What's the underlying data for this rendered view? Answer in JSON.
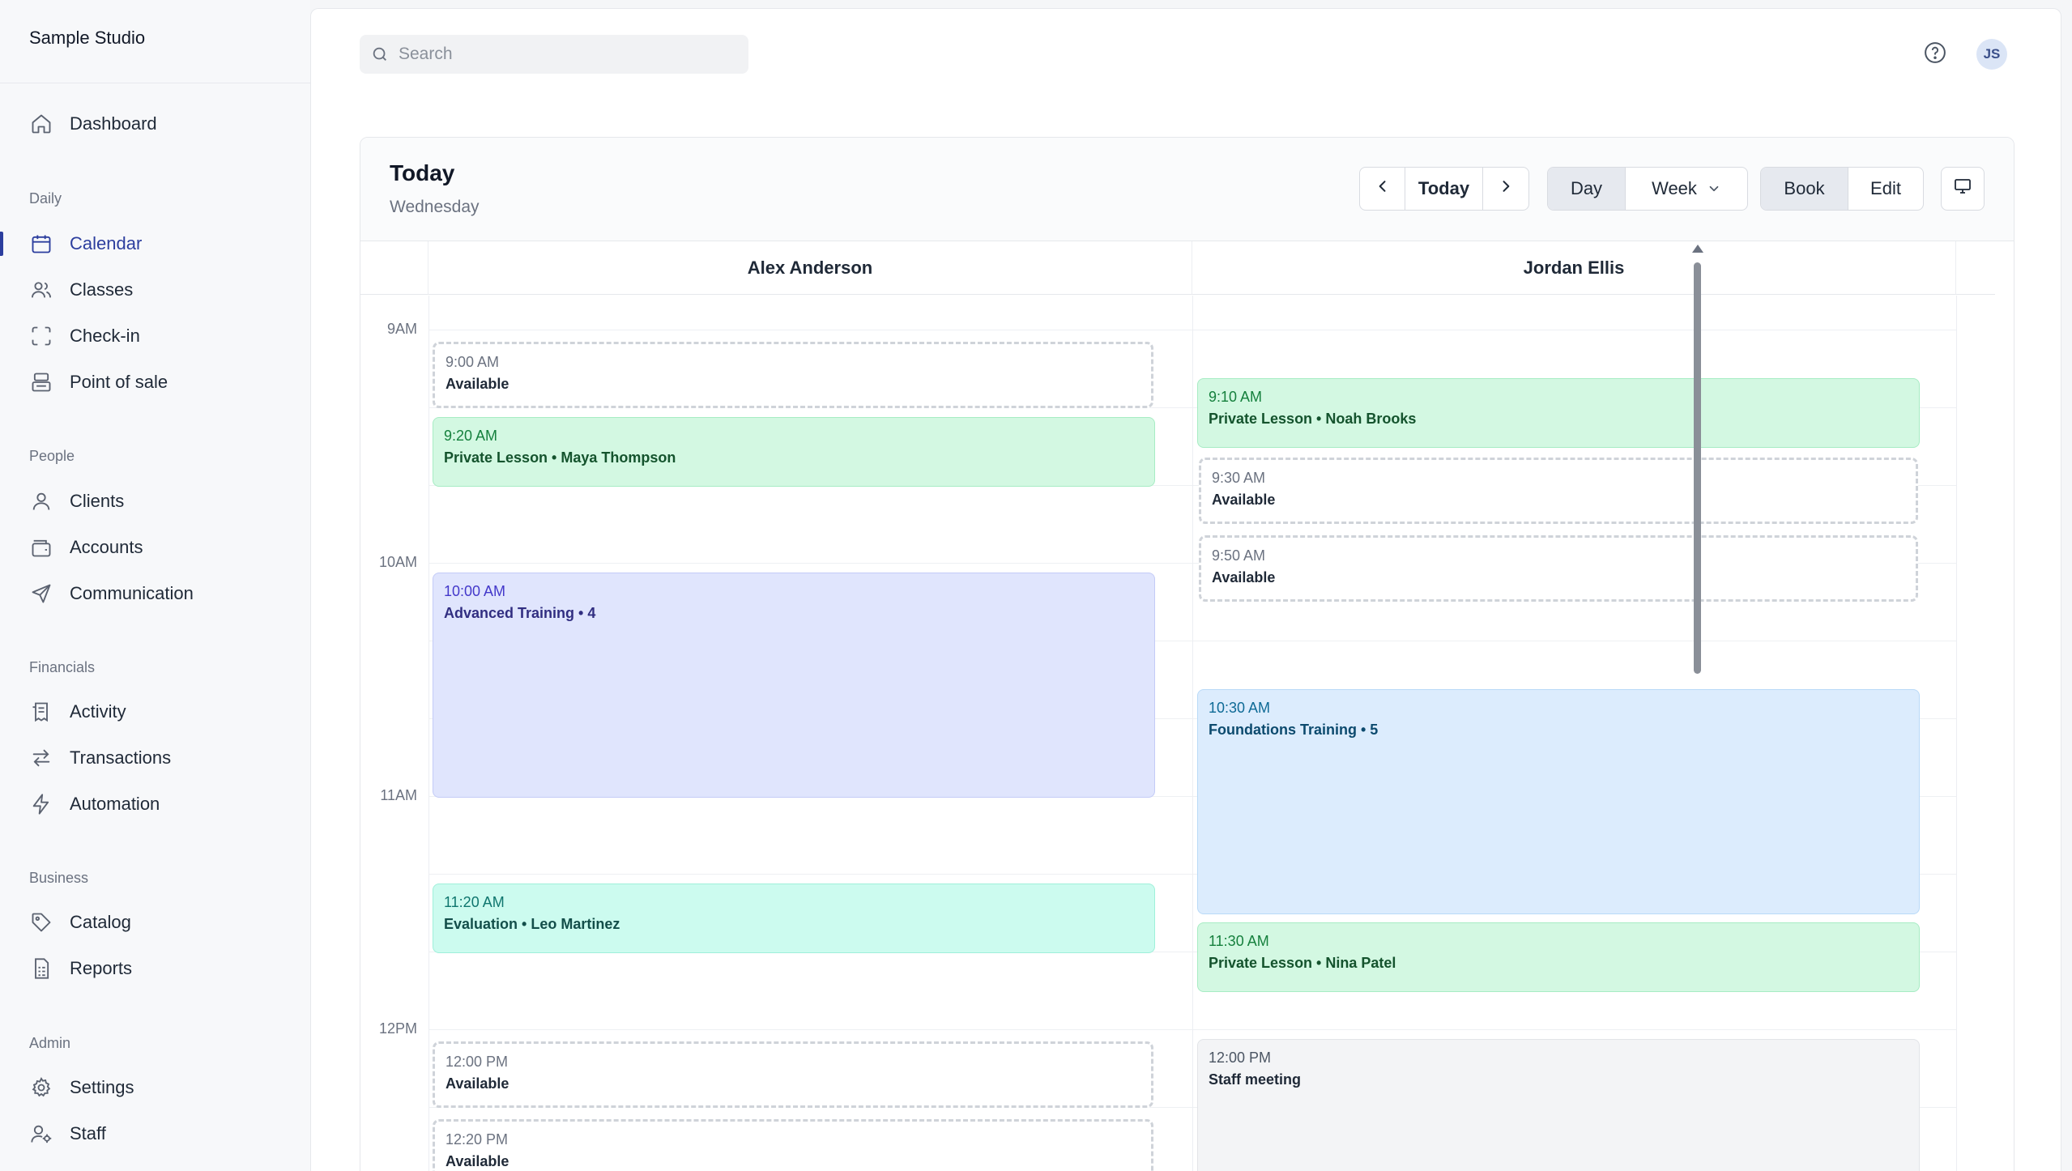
{
  "brand": "Sample Studio",
  "sidebar": {
    "top": [
      {
        "label": "Dashboard",
        "icon": "home-icon"
      }
    ],
    "sections": [
      {
        "label": "Daily",
        "items": [
          {
            "label": "Calendar",
            "icon": "calendar-icon",
            "active": true
          },
          {
            "label": "Classes",
            "icon": "users-icon"
          },
          {
            "label": "Check-in",
            "icon": "scan-icon"
          },
          {
            "label": "Point of sale",
            "icon": "register-icon"
          }
        ]
      },
      {
        "label": "People",
        "items": [
          {
            "label": "Clients",
            "icon": "user-icon"
          },
          {
            "label": "Accounts",
            "icon": "wallet-icon"
          },
          {
            "label": "Communication",
            "icon": "send-icon"
          }
        ]
      },
      {
        "label": "Financials",
        "items": [
          {
            "label": "Activity",
            "icon": "receipt-icon"
          },
          {
            "label": "Transactions",
            "icon": "arrows-icon"
          },
          {
            "label": "Automation",
            "icon": "bolt-icon"
          }
        ]
      },
      {
        "label": "Business",
        "items": [
          {
            "label": "Catalog",
            "icon": "tag-icon"
          },
          {
            "label": "Reports",
            "icon": "report-icon"
          }
        ]
      },
      {
        "label": "Admin",
        "items": [
          {
            "label": "Settings",
            "icon": "gear-icon"
          },
          {
            "label": "Staff",
            "icon": "staff-icon"
          }
        ]
      }
    ]
  },
  "header": {
    "search_placeholder": "Search",
    "avatar_initials": "JS"
  },
  "calendar": {
    "title": "Today",
    "subtitle": "Wednesday",
    "nav": {
      "today": "Today"
    },
    "views": {
      "day": "Day",
      "week": "Week"
    },
    "modes": {
      "book": "Book",
      "edit": "Edit"
    },
    "hours": [
      "9AM",
      "10AM",
      "11AM",
      "12PM"
    ],
    "columns": [
      {
        "name": "Alex Anderson",
        "events": [
          {
            "time": "9:00 AM",
            "title": "Available",
            "kind": "available"
          },
          {
            "time": "9:20 AM",
            "title": "Private Lesson • Maya Thompson",
            "kind": "green"
          },
          {
            "time": "10:00 AM",
            "title": "Advanced Training • 4",
            "kind": "purple"
          },
          {
            "time": "11:20 AM",
            "title": "Evaluation • Leo Martinez",
            "kind": "teal"
          },
          {
            "time": "12:00 PM",
            "title": "Available",
            "kind": "available"
          },
          {
            "time": "12:20 PM",
            "title": "Available",
            "kind": "available"
          }
        ]
      },
      {
        "name": "Jordan Ellis",
        "events": [
          {
            "time": "9:10 AM",
            "title": "Private Lesson • Noah Brooks",
            "kind": "green"
          },
          {
            "time": "9:30 AM",
            "title": "Available",
            "kind": "available"
          },
          {
            "time": "9:50 AM",
            "title": "Available",
            "kind": "available"
          },
          {
            "time": "10:30 AM",
            "title": "Foundations Training • 5",
            "kind": "blue"
          },
          {
            "time": "11:30 AM",
            "title": "Private Lesson • Nina Patel",
            "kind": "green"
          },
          {
            "time": "12:00 PM",
            "title": "Staff meeting",
            "kind": "gray"
          }
        ]
      }
    ]
  }
}
